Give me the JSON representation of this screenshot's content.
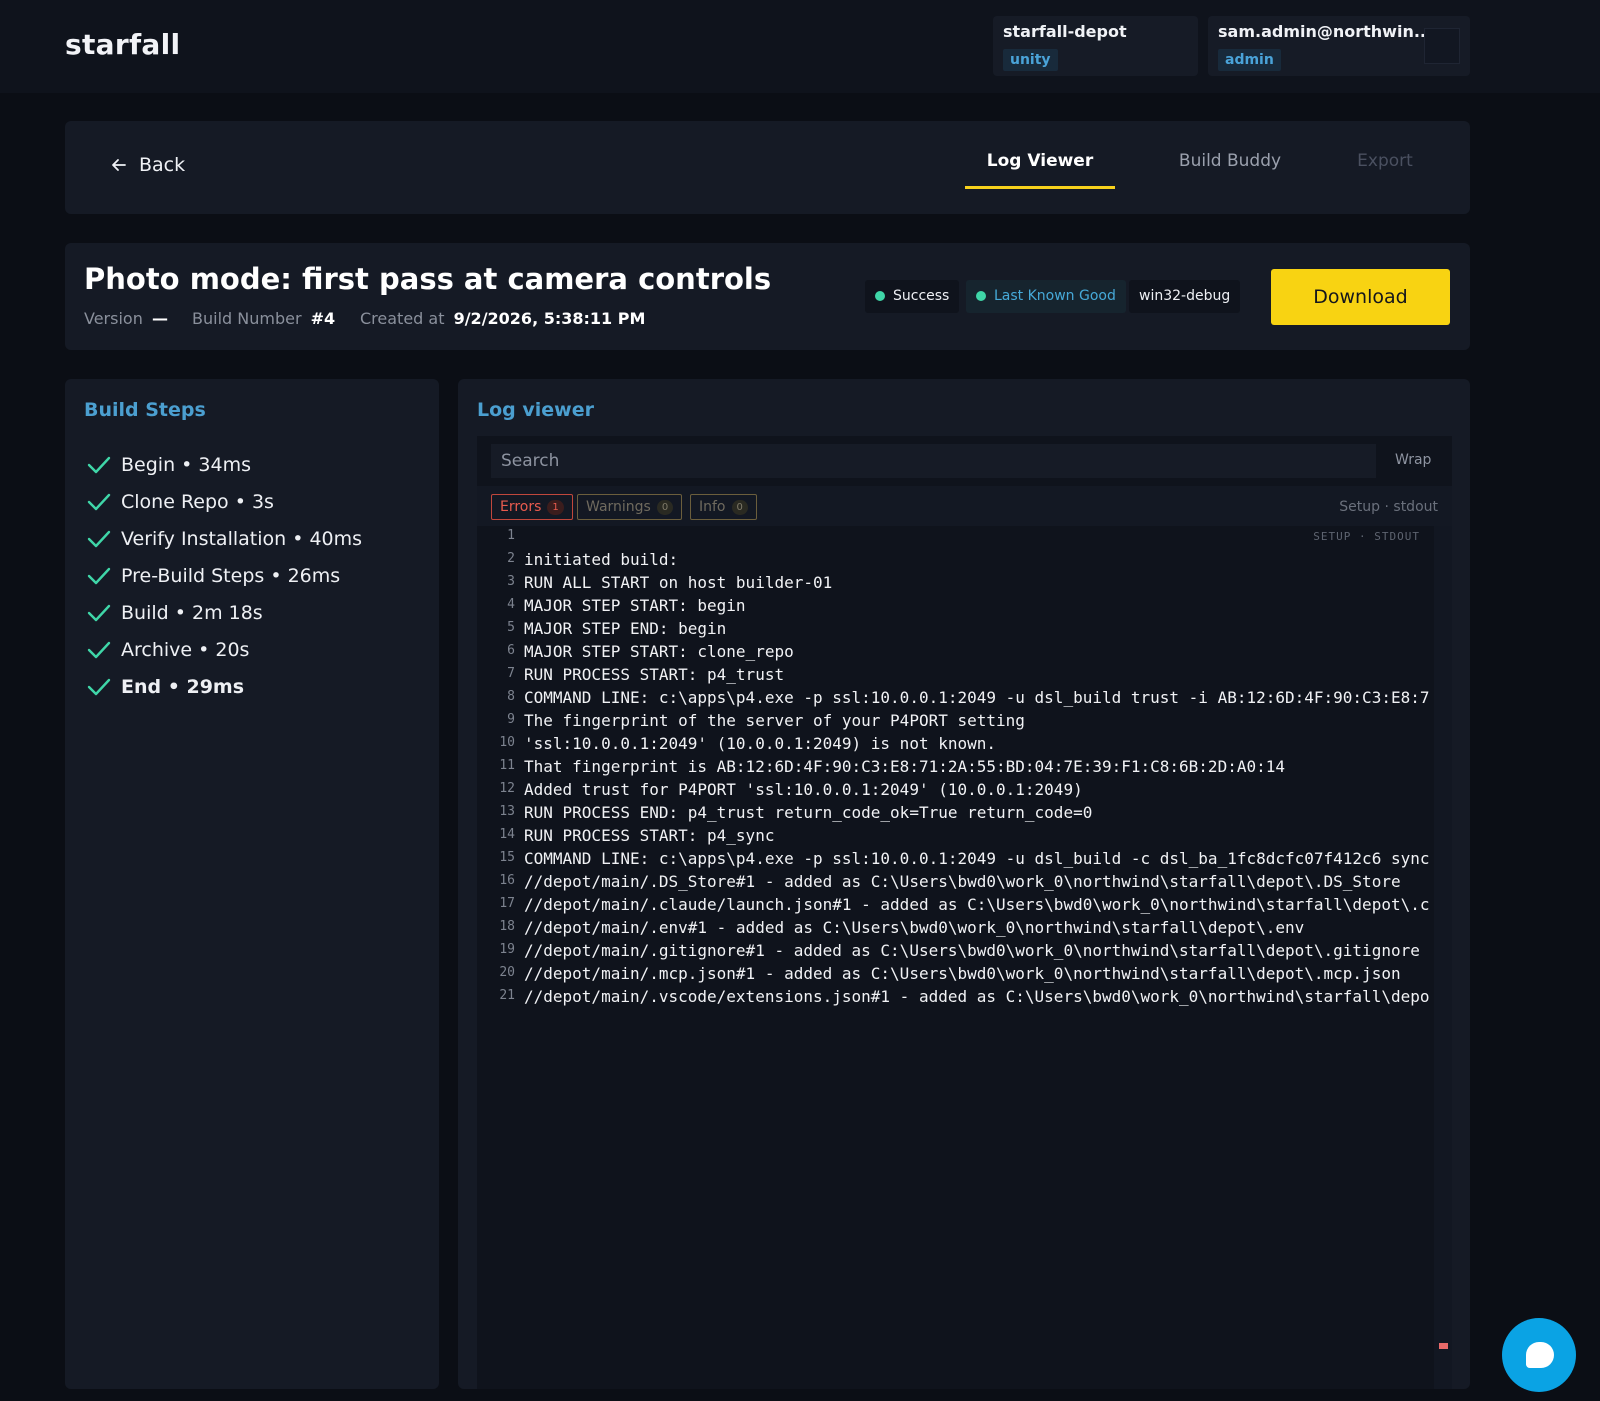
{
  "app": {
    "logo": "starfall"
  },
  "account": {
    "workspace": {
      "name": "starfall-depot",
      "tag": "unity"
    },
    "user": {
      "name": "sam.admin@northwin...",
      "tag": "admin"
    }
  },
  "nav": {
    "back_label": "Back",
    "tabs": [
      {
        "label": "Log Viewer",
        "state": "active"
      },
      {
        "label": "Build Buddy",
        "state": "normal"
      },
      {
        "label": "Export",
        "state": "disabled"
      }
    ]
  },
  "build": {
    "title": "Photo mode: first pass at camera controls",
    "version_label": "Version",
    "version_value": "—",
    "number_label": "Build Number",
    "number_value": "#4",
    "created_label": "Created at",
    "created_value": "9/2/2026, 5:38:11 PM",
    "badges": [
      "Success",
      "Last Known Good",
      "win32-debug"
    ],
    "download_label": "Download",
    "colors": {
      "success": "#3fd6a8",
      "accent": "#f8d312",
      "section": "#4b9fd0"
    }
  },
  "steps": {
    "title": "Build Steps",
    "items": [
      {
        "label": "Begin • 34ms"
      },
      {
        "label": "Clone Repo • 3s"
      },
      {
        "label": "Verify Installation • 40ms"
      },
      {
        "label": "Pre-Build Steps • 26ms"
      },
      {
        "label": "Build • 2m 18s"
      },
      {
        "label": "Archive • 20s"
      },
      {
        "label": "End • 29ms"
      }
    ]
  },
  "log": {
    "title": "Log viewer",
    "search_placeholder": "Search",
    "wrap_label": "Wrap",
    "filters": {
      "errors": {
        "label": "Errors",
        "count": "1"
      },
      "warnings": {
        "label": "Warnings",
        "count": "0"
      },
      "info": {
        "label": "Info",
        "count": "0"
      }
    },
    "source_label": "Setup · stdout",
    "line_tag": "SETUP · STDOUT",
    "lines": [
      {
        "n": "1",
        "text": ""
      },
      {
        "n": "2",
        "text": "initiated build:"
      },
      {
        "n": "3",
        "text": "RUN ALL START on host builder-01"
      },
      {
        "n": "4",
        "text": "MAJOR STEP START: begin"
      },
      {
        "n": "5",
        "text": "MAJOR STEP END: begin"
      },
      {
        "n": "6",
        "text": "MAJOR STEP START: clone_repo"
      },
      {
        "n": "7",
        "text": "RUN PROCESS START: p4_trust"
      },
      {
        "n": "8",
        "text": "COMMAND LINE: c:\\apps\\p4.exe -p ssl:10.0.0.1:2049 -u dsl_build trust -i AB:12:6D:4F:90:C3:E8:7"
      },
      {
        "n": "9",
        "text": "The fingerprint of the server of your P4PORT setting"
      },
      {
        "n": "10",
        "text": "'ssl:10.0.0.1:2049' (10.0.0.1:2049) is not known."
      },
      {
        "n": "11",
        "text": "That fingerprint is AB:12:6D:4F:90:C3:E8:71:2A:55:BD:04:7E:39:F1:C8:6B:2D:A0:14"
      },
      {
        "n": "12",
        "text": "Added trust for P4PORT 'ssl:10.0.0.1:2049' (10.0.0.1:2049)"
      },
      {
        "n": "13",
        "text": "RUN PROCESS END: p4_trust return_code_ok=True return_code=0"
      },
      {
        "n": "14",
        "text": "RUN PROCESS START: p4_sync"
      },
      {
        "n": "15",
        "text": "COMMAND LINE: c:\\apps\\p4.exe -p ssl:10.0.0.1:2049 -u dsl_build -c dsl_ba_1fc8dcfc07f412c6 sync"
      },
      {
        "n": "16",
        "text": "//depot/main/.DS_Store#1 - added as C:\\Users\\bwd0\\work_0\\northwind\\starfall\\depot\\.DS_Store"
      },
      {
        "n": "17",
        "text": "//depot/main/.claude/launch.json#1 - added as C:\\Users\\bwd0\\work_0\\northwind\\starfall\\depot\\.c"
      },
      {
        "n": "18",
        "text": "//depot/main/.env#1 - added as C:\\Users\\bwd0\\work_0\\northwind\\starfall\\depot\\.env"
      },
      {
        "n": "19",
        "text": "//depot/main/.gitignore#1 - added as C:\\Users\\bwd0\\work_0\\northwind\\starfall\\depot\\.gitignore"
      },
      {
        "n": "20",
        "text": "//depot/main/.mcp.json#1 - added as C:\\Users\\bwd0\\work_0\\northwind\\starfall\\depot\\.mcp.json"
      },
      {
        "n": "21",
        "text": "//depot/main/.vscode/extensions.json#1 - added as C:\\Users\\bwd0\\work_0\\northwind\\starfall\\depo"
      }
    ]
  }
}
